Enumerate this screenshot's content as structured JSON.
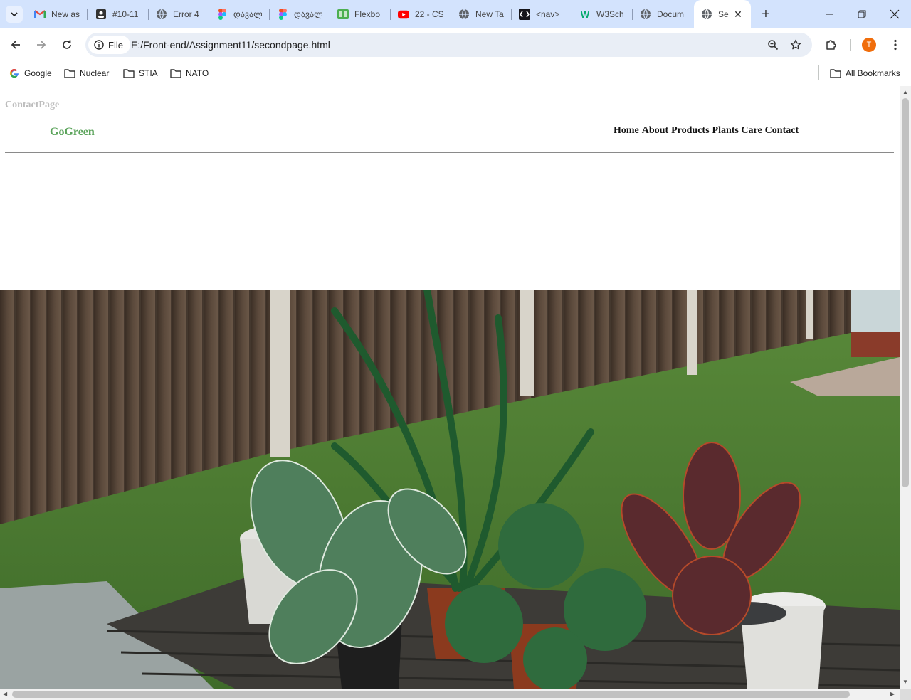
{
  "browser": {
    "tabs": [
      {
        "title": "New as",
        "icon": "gmail-icon"
      },
      {
        "title": "#10-11",
        "icon": "contact-card-icon"
      },
      {
        "title": "Error 4",
        "icon": "globe-icon"
      },
      {
        "title": "დავალ",
        "icon": "figma-icon"
      },
      {
        "title": "დავალ",
        "icon": "figma-icon"
      },
      {
        "title": "Flexbo",
        "icon": "flexbox-icon"
      },
      {
        "title": "22 - CS",
        "icon": "youtube-icon"
      },
      {
        "title": "New Ta",
        "icon": "globe-icon"
      },
      {
        "title": "<nav>",
        "icon": "code-icon"
      },
      {
        "title": "W3Sch",
        "icon": "w3schools-icon"
      },
      {
        "title": "Docum",
        "icon": "globe-icon"
      }
    ],
    "active_tab": {
      "title": "Se",
      "icon": "globe-icon"
    },
    "address": {
      "chip_label": "File",
      "url": "E:/Front-end/Assignment11/secondpage.html"
    },
    "profile_initial": "T",
    "bookmarks": [
      {
        "label": "Google",
        "icon": "google-icon"
      },
      {
        "label": "Nuclear",
        "icon": "folder-icon"
      },
      {
        "label": "STIA",
        "icon": "folder-icon"
      },
      {
        "label": "NATO",
        "icon": "folder-icon"
      }
    ],
    "all_bookmarks_label": "All Bookmarks"
  },
  "page": {
    "heading": "ContactPage",
    "logo": "GoGreen",
    "nav": [
      "Home",
      "About",
      "Products",
      "Plants Care",
      "Contact"
    ],
    "hero_image": "potted-plants-on-garden-table-photo"
  },
  "colors": {
    "tabstrip": "#d3e3fd",
    "logo_green": "#5aa35a",
    "heading_gray": "#bdbdbd",
    "avatar_orange": "#f06d0b"
  }
}
